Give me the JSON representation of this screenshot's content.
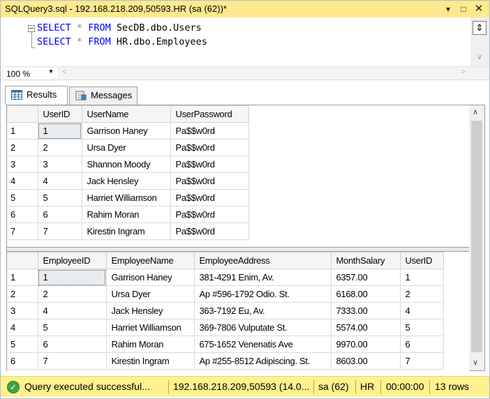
{
  "window": {
    "title": "SQLQuery3.sql - 192.168.218.209,50593.HR (sa (62))*"
  },
  "editor": {
    "lines": [
      {
        "kw1": "SELECT",
        "op": "*",
        "kw2": "FROM",
        "object": "SecDB.dbo.Users"
      },
      {
        "kw1": "SELECT",
        "op": "*",
        "kw2": "FROM",
        "object": "HR.dbo.Employees"
      }
    ]
  },
  "zoom": {
    "value": "100 %"
  },
  "tabs": {
    "results": "Results",
    "messages": "Messages"
  },
  "grid1": {
    "columns": [
      "UserID",
      "UserName",
      "UserPassword"
    ],
    "rows": [
      [
        "1",
        "1",
        "Garrison Haney",
        "Pa$$w0rd"
      ],
      [
        "2",
        "2",
        "Ursa Dyer",
        "Pa$$w0rd"
      ],
      [
        "3",
        "3",
        "Shannon Moody",
        "Pa$$w0rd"
      ],
      [
        "4",
        "4",
        "Jack Hensley",
        "Pa$$w0rd"
      ],
      [
        "5",
        "5",
        "Harriet Williamson",
        "Pa$$w0rd"
      ],
      [
        "6",
        "6",
        "Rahim Moran",
        "Pa$$w0rd"
      ],
      [
        "7",
        "7",
        "Kirestin Ingram",
        "Pa$$w0rd"
      ]
    ]
  },
  "grid2": {
    "columns": [
      "EmployeeID",
      "EmployeeName",
      "EmployeeAddress",
      "MonthSalary",
      "UserID"
    ],
    "rows": [
      [
        "1",
        "1",
        "Garrison Haney",
        "381-4291 Enim, Av.",
        "6357.00",
        "1"
      ],
      [
        "2",
        "2",
        "Ursa Dyer",
        "Ap #596-1792 Odio. St.",
        "6168.00",
        "2"
      ],
      [
        "3",
        "4",
        "Jack Hensley",
        "363-7192 Eu, Av.",
        "7333.00",
        "4"
      ],
      [
        "4",
        "5",
        "Harriet Williamson",
        "369-7806 Vulputate St.",
        "5574.00",
        "5"
      ],
      [
        "5",
        "6",
        "Rahim Moran",
        "675-1652 Venenatis Ave",
        "9970.00",
        "6"
      ],
      [
        "6",
        "7",
        "Kirestin Ingram",
        "Ap #255-8512 Adipiscing. St.",
        "8603.00",
        "7"
      ]
    ]
  },
  "status": {
    "message": "Query executed successful...",
    "server": "192.168.218.209,50593 (14.0...",
    "user": "sa (62)",
    "database": "HR",
    "elapsed": "00:00:00",
    "rows": "13 rows"
  },
  "colors": {
    "titlebar": "#ffe98e",
    "statusbar": "#fff190",
    "keyword": "#0000ff",
    "operator": "#808080",
    "success": "#3fa53f"
  },
  "icons": {
    "results_tab": "grid-icon",
    "messages_tab": "messages-icon",
    "status": "success-check-icon"
  }
}
